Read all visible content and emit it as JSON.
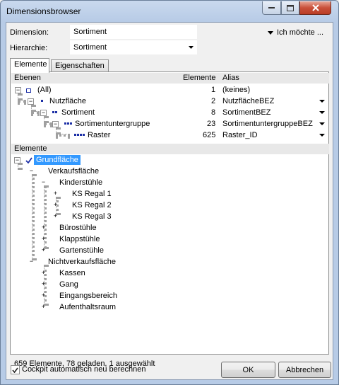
{
  "window": {
    "title": "Dimensionsbrowser"
  },
  "form": {
    "dimension_label": "Dimension:",
    "dimension_value": "Sortiment",
    "hierarchy_label": "Hierarchie:",
    "hierarchy_value": "Sortiment",
    "menu_label": "Ich möchte ..."
  },
  "tabs": [
    {
      "label": "Elemente",
      "active": true
    },
    {
      "label": "Eigenschaften",
      "active": false
    }
  ],
  "levels": {
    "headers": {
      "name": "Ebenen",
      "count": "Elemente",
      "alias": "Alias"
    },
    "rows": [
      {
        "name": "(All)",
        "count": "1",
        "alias": "(keines)",
        "dropdown": false
      },
      {
        "name": "Nutzfläche",
        "count": "2",
        "alias": "NutzflächeBEZ",
        "dropdown": true
      },
      {
        "name": "Sortiment",
        "count": "8",
        "alias": "SortimentBEZ",
        "dropdown": true
      },
      {
        "name": "Sortimentuntergruppe",
        "count": "23",
        "alias": "SortimentuntergruppeBEZ",
        "dropdown": true
      },
      {
        "name": "Raster",
        "count": "625",
        "alias": "Raster_ID",
        "dropdown": true
      }
    ]
  },
  "elements": {
    "header": "Elemente",
    "tree": [
      {
        "label": "Grundfläche",
        "selected": true
      },
      {
        "label": "Verkaufsfläche"
      },
      {
        "label": "Kinderstühle"
      },
      {
        "label": "KS Regal 1"
      },
      {
        "label": "KS Regal 2"
      },
      {
        "label": "KS Regal 3"
      },
      {
        "label": "Bürostühle"
      },
      {
        "label": "Klappstühle"
      },
      {
        "label": "Gartenstühle"
      },
      {
        "label": "Nichtverkaufsfläche"
      },
      {
        "label": "Kassen"
      },
      {
        "label": "Gang"
      },
      {
        "label": "Eingangsbereich"
      },
      {
        "label": "Aufenthaltsraum"
      }
    ]
  },
  "status": "659 Elemente, 78 geladen, 1 ausgewählt",
  "footer": {
    "checkbox_label": "Cockpit automatisch neu berechnen",
    "checkbox_checked": true,
    "ok_label": "OK",
    "cancel_label": "Abbrechen"
  },
  "colors": {
    "selection": "#3399ff",
    "level_icon": "#1c2fa6"
  }
}
